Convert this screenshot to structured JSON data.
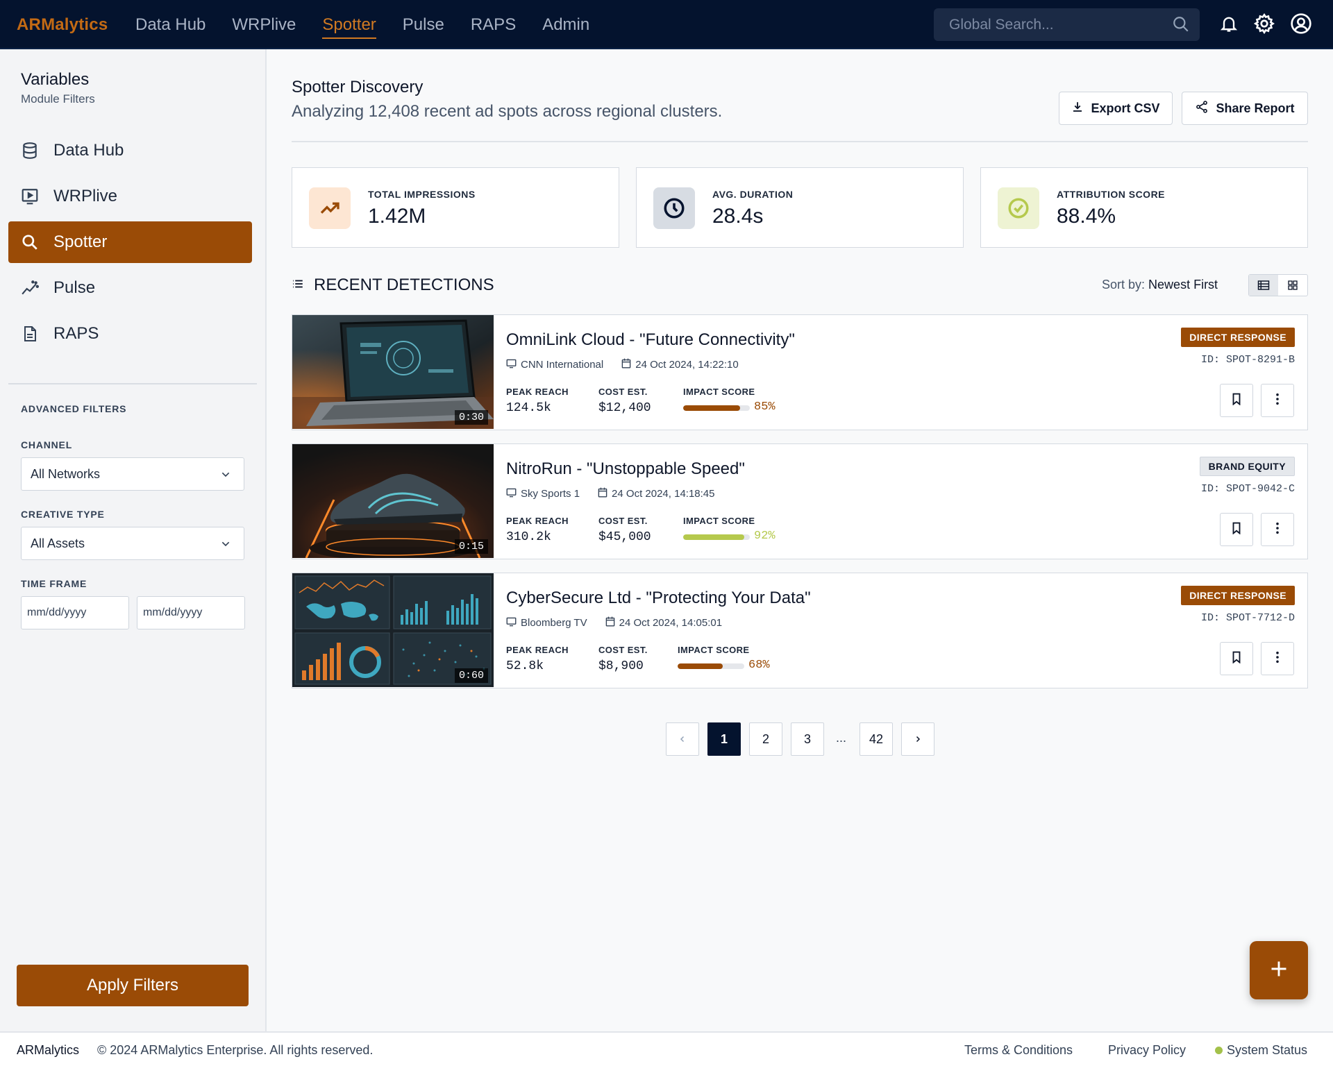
{
  "brand": "ARMalytics",
  "colors": {
    "accent": "#9a4b06",
    "nav_bg": "#04132e",
    "lime": "#b5c94d"
  },
  "topnav": {
    "items": [
      "Data Hub",
      "WRPlive",
      "Spotter",
      "Pulse",
      "RAPS",
      "Admin"
    ],
    "active": "Spotter"
  },
  "search": {
    "placeholder": "Global Search..."
  },
  "top_icons": [
    "search-icon",
    "bell-icon",
    "gear-icon",
    "user-circle-icon"
  ],
  "sidebar": {
    "title": "Variables",
    "subtitle": "Module Filters",
    "items": [
      {
        "label": "Data Hub",
        "icon": "database-icon"
      },
      {
        "label": "WRPlive",
        "icon": "monitor-play-icon"
      },
      {
        "label": "Spotter",
        "icon": "search-icon",
        "active": true
      },
      {
        "label": "Pulse",
        "icon": "pulse-chart-icon"
      },
      {
        "label": "RAPS",
        "icon": "document-icon"
      }
    ],
    "advanced_filters": "ADVANCED FILTERS",
    "channel_label": "CHANNEL",
    "channel_value": "All Networks",
    "creative_label": "CREATIVE TYPE",
    "creative_value": "All Assets",
    "timeframe_label": "TIME FRAME",
    "date_placeholder": "mm/dd/yyyy",
    "apply_label": "Apply Filters"
  },
  "main": {
    "title": "Spotter Discovery",
    "subtitle": "Analyzing 12,408 recent ad spots across regional clusters.",
    "export_label": "Export CSV",
    "share_label": "Share Report"
  },
  "kpis": [
    {
      "label": "TOTAL IMPRESSIONS",
      "value": "1.42M",
      "icon": "trending-up-icon"
    },
    {
      "label": "AVG. DURATION",
      "value": "28.4s",
      "icon": "clock-icon"
    },
    {
      "label": "ATTRIBUTION SCORE",
      "value": "88.4%",
      "icon": "check-circle-icon"
    }
  ],
  "detections": {
    "title": "RECENT DETECTIONS",
    "sort_label": "Sort by:",
    "sort_value": "Newest First",
    "metric_labels": {
      "reach": "PEAK REACH",
      "cost": "COST EST.",
      "impact": "IMPACT SCORE"
    },
    "items": [
      {
        "title": "OmniLink Cloud - \"Future Connectivity\"",
        "channel": "CNN International",
        "datetime": "24 Oct 2024, 14:22:10",
        "duration": "0:30",
        "reach": "124.5k",
        "cost": "$12,400",
        "impact": 85,
        "impact_text": "85%",
        "badge": "DIRECT RESPONSE",
        "spot_id": "ID: SPOT-8291-B"
      },
      {
        "title": "NitroRun - \"Unstoppable Speed\"",
        "channel": "Sky Sports 1",
        "datetime": "24 Oct 2024, 14:18:45",
        "duration": "0:15",
        "reach": "310.2k",
        "cost": "$45,000",
        "impact": 92,
        "impact_text": "92%",
        "badge": "BRAND EQUITY",
        "spot_id": "ID: SPOT-9042-C"
      },
      {
        "title": "CyberSecure Ltd - \"Protecting Your Data\"",
        "channel": "Bloomberg TV",
        "datetime": "24 Oct 2024, 14:05:01",
        "duration": "0:60",
        "reach": "52.8k",
        "cost": "$8,900",
        "impact": 68,
        "impact_text": "68%",
        "badge": "DIRECT RESPONSE",
        "spot_id": "ID: SPOT-7712-D"
      }
    ]
  },
  "pagination": {
    "pages": [
      "1",
      "2",
      "3",
      "42"
    ],
    "ellipsis": "...",
    "current": "1"
  },
  "footer": {
    "brand": "ARMalytics",
    "copyright": "© 2024 ARMalytics Enterprise. All rights reserved.",
    "terms": "Terms & Conditions",
    "privacy": "Privacy Policy",
    "status": "System Status"
  }
}
